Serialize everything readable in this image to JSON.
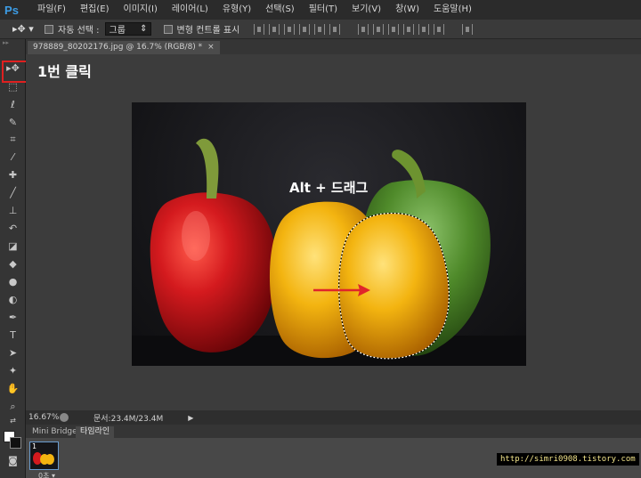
{
  "app": {
    "logo": "Ps"
  },
  "menu": [
    "파일(F)",
    "편집(E)",
    "이미지(I)",
    "레이어(L)",
    "유형(Y)",
    "선택(S)",
    "필터(T)",
    "보기(V)",
    "창(W)",
    "도움말(H)"
  ],
  "options": {
    "auto_select_label": "자동 선택 :",
    "auto_select_value": "그룹",
    "transform_controls_label": "변형 컨트롤 표시"
  },
  "document": {
    "tab_title": "978889_80202176.jpg @ 16.7% (RGB/8) *",
    "close": "×"
  },
  "annotations": {
    "step1": "1번 클릭",
    "alt_drag": "Alt + 드래그"
  },
  "status": {
    "zoom": "16.67%",
    "doc_size": "문서:23.4M/23.4M"
  },
  "panel": {
    "tabs": [
      "Mini Bridge",
      "타임라인"
    ],
    "frame_number": "1",
    "frame_time": "0초 ▾"
  },
  "watermark": "http://simri0908.tistory.com",
  "colors": {
    "highlight": "#e02020",
    "arrow": "#e0252a",
    "red_pepper": "#d41a1e",
    "yellow_pepper": "#f3b410",
    "green_pepper": "#4f8a2a"
  }
}
